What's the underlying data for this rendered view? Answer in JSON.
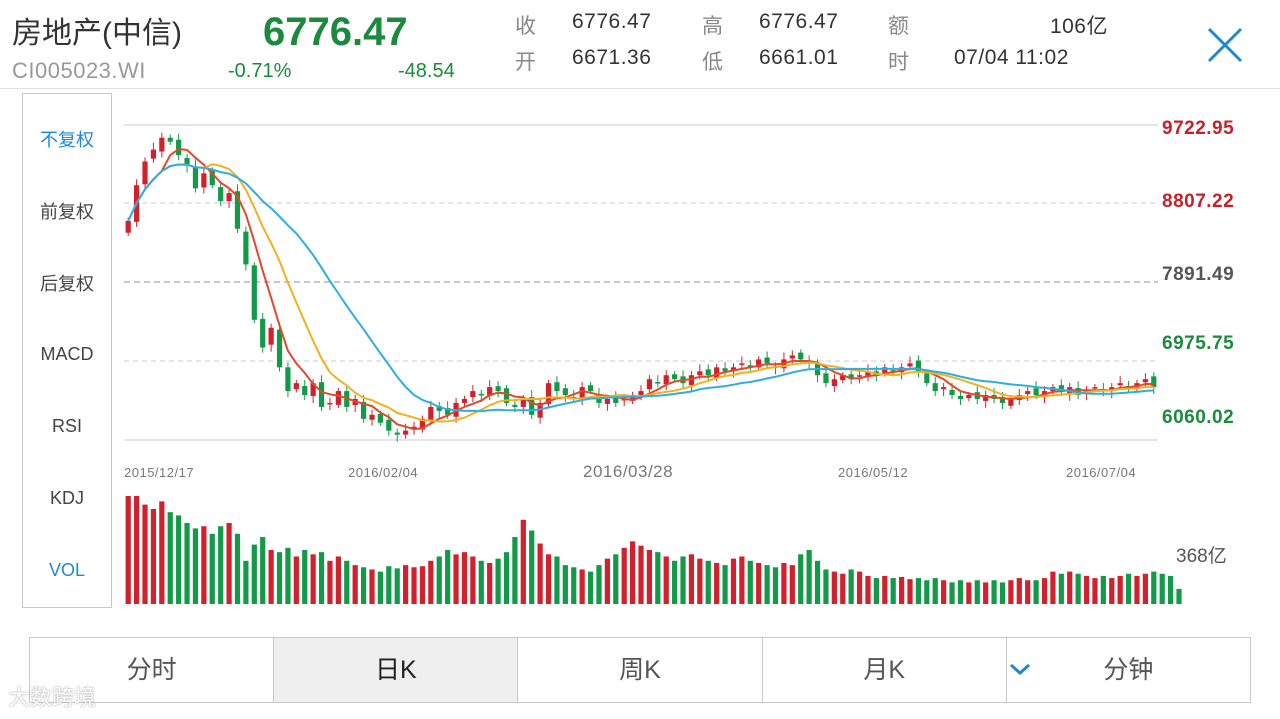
{
  "header": {
    "name": "房地产(中信)",
    "code": "CI005023.WI",
    "price": "6776.47",
    "change_pct": "-0.71%",
    "change_abs": "-48.54",
    "stats": [
      {
        "label": "收",
        "value": "6776.47"
      },
      {
        "label": "高",
        "value": "6776.47"
      },
      {
        "label": "额",
        "value": "106亿"
      },
      {
        "label": "开",
        "value": "6671.36"
      },
      {
        "label": "低",
        "value": "6661.01"
      },
      {
        "label": "时",
        "value": "07/04 11:02"
      }
    ]
  },
  "sidebar": {
    "items": [
      "不复权",
      "前复权",
      "后复权",
      "MACD",
      "RSI",
      "KDJ",
      "VOL"
    ],
    "active": [
      "不复权",
      "VOL"
    ]
  },
  "chart_data": {
    "type": "candlestick",
    "y_ticks": [
      "9722.95",
      "8807.22",
      "7891.49",
      "6975.75",
      "6060.02"
    ],
    "y_range": [
      6060.02,
      9722.95
    ],
    "x_labels": [
      "2015/12/17",
      "2016/02/04",
      "2016/03/28",
      "2016/05/12",
      "2016/07/04"
    ],
    "volume_label": "368亿",
    "colors": {
      "up": "#d0212c",
      "down": "#139a48",
      "ma5": "#e0492c",
      "ma10": "#f2b11f",
      "ma20": "#2eaee0"
    },
    "closes": [
      8550,
      9000,
      9300,
      9450,
      9600,
      9550,
      9380,
      9250,
      8960,
      9150,
      9000,
      8800,
      8900,
      8450,
      8000,
      7300,
      6950,
      7200,
      6700,
      6400,
      6500,
      6350,
      6500,
      6200,
      6250,
      6400,
      6200,
      6300,
      6050,
      6100,
      6000,
      5900,
      5850,
      5900,
      5950,
      6050,
      6200,
      6150,
      6100,
      6250,
      6300,
      6400,
      6350,
      6450,
      6400,
      6250,
      6200,
      6300,
      6100,
      6250,
      6500,
      6400,
      6350,
      6300,
      6450,
      6400,
      6250,
      6300,
      6250,
      6300,
      6350,
      6400,
      6550,
      6500,
      6600,
      6550,
      6500,
      6600,
      6650,
      6600,
      6700,
      6650,
      6700,
      6750,
      6700,
      6800,
      6750,
      6700,
      6800,
      6850,
      6800,
      6750,
      6600,
      6500,
      6550,
      6600,
      6550,
      6600,
      6650,
      6600,
      6700,
      6650,
      6700,
      6750,
      6650,
      6500,
      6400,
      6450,
      6350,
      6300,
      6350,
      6300,
      6350,
      6300,
      6250,
      6300,
      6350,
      6400,
      6350,
      6400,
      6450,
      6400,
      6450,
      6350,
      6400,
      6450,
      6400,
      6450,
      6500,
      6450,
      6500,
      6550,
      6450
    ],
    "volumes": [
      100,
      100,
      92,
      88,
      95,
      85,
      82,
      75,
      70,
      72,
      65,
      72,
      75,
      65,
      40,
      55,
      62,
      50,
      48,
      52,
      44,
      50,
      46,
      48,
      40,
      44,
      40,
      36,
      34,
      32,
      30,
      35,
      33,
      36,
      34,
      35,
      40,
      44,
      50,
      46,
      48,
      44,
      40,
      38,
      42,
      48,
      62,
      78,
      68,
      56,
      46,
      44,
      36,
      34,
      32,
      30,
      36,
      42,
      46,
      52,
      58,
      54,
      50,
      48,
      44,
      40,
      44,
      46,
      42,
      40,
      38,
      36,
      42,
      44,
      40,
      38,
      36,
      34,
      38,
      36,
      46,
      50,
      40,
      32,
      30,
      28,
      32,
      30,
      26,
      24,
      26,
      24,
      25,
      23,
      24,
      22,
      24,
      22,
      20,
      22,
      20,
      22,
      20,
      22,
      20,
      22,
      24,
      22,
      22,
      24,
      30,
      28,
      30,
      28,
      26,
      24,
      26,
      24,
      26,
      28,
      26,
      28,
      30,
      28,
      26,
      14
    ]
  },
  "tabs": {
    "items": [
      "分时",
      "日K",
      "周K",
      "月K",
      "分钟"
    ],
    "selected": "日K"
  },
  "watermark": "大数跨境"
}
